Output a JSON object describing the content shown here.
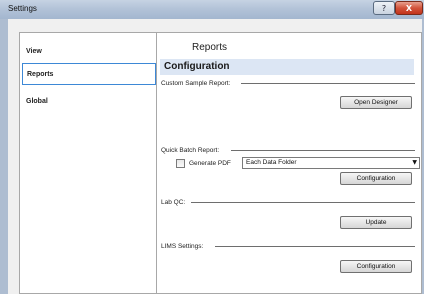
{
  "window": {
    "title": "Settings",
    "help_label": "?",
    "close_label": "X"
  },
  "nav": {
    "items": [
      {
        "label": "View"
      },
      {
        "label": "Reports"
      },
      {
        "label": "Global"
      }
    ]
  },
  "main": {
    "page_title": "Reports",
    "section_title": "Configuration",
    "custom_sample_report": {
      "label": "Custom Sample Report:",
      "button": "Open Designer",
      "generate_pdf_label": "Generate PDF",
      "generate_pdf_checked": false,
      "pdf_option": "Each Data Folder"
    },
    "quick_batch_report": {
      "label": "Quick Batch Report:",
      "button": "Configuration"
    },
    "lab_qc": {
      "label": "Lab QC:",
      "button": "Update"
    },
    "lims_settings": {
      "label": "LIMS Settings:",
      "button": "Configuration"
    }
  },
  "icons": {
    "dropdown": "chevron-down-icon"
  }
}
